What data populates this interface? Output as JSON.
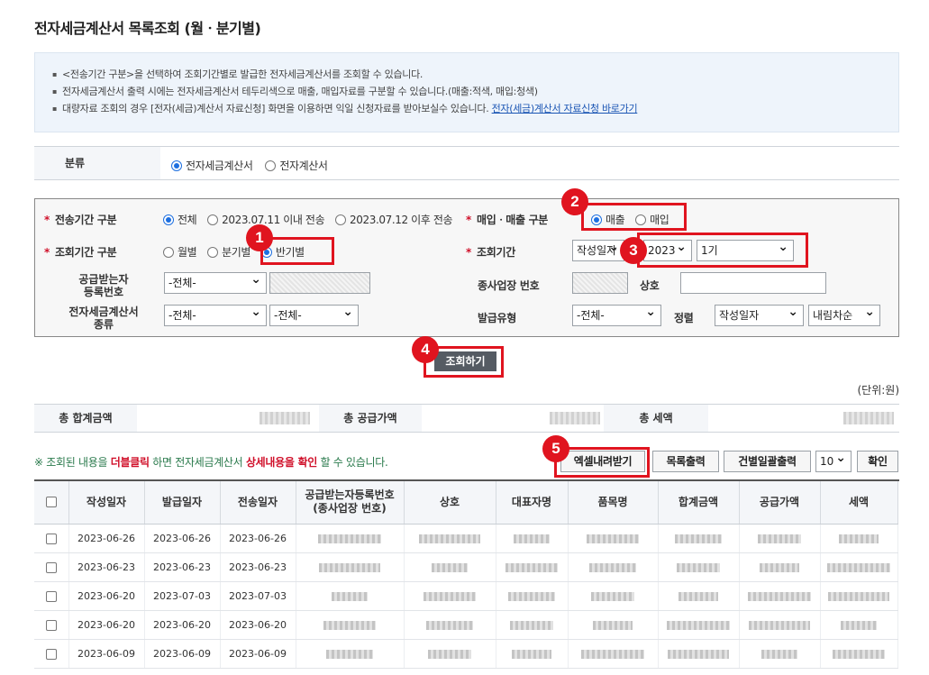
{
  "page_title": "전자세금계산서 목록조회 (월ㆍ분기별)",
  "notice": {
    "lines": [
      "<전송기간 구분>을 선택하여 조회기간별로 발급한 전자세금계산서를 조회할 수 있습니다.",
      "전자세금계산서 출력 시에는 전자세금계산서 테두리색으로 매출, 매입자료를 구분할 수 있습니다.(매출:적색, 매입:청색)",
      "대량자료 조회의 경우 [전자(세금)계산서 자료신청] 화면을 이용하면 익일 신청자료를 받아보실수 있습니다. "
    ],
    "link": "전자(세금)계산서 자료신청 바로가기"
  },
  "classification": {
    "label": "분류",
    "options": [
      "전자세금계산서",
      "전자계산서"
    ],
    "selected": "전자세금계산서"
  },
  "search": {
    "send_period_label": "전송기간 구분",
    "send_period_options": [
      "전체",
      "2023.07.11 이내 전송",
      "2023.07.12 이후 전송"
    ],
    "trade_type_label": "매입ㆍ매출 구분",
    "trade_type_options": [
      "매출",
      "매입"
    ],
    "query_period_label": "조회기간 구분",
    "query_period_options": [
      "월별",
      "분기별",
      "반기별"
    ],
    "query_range_label": "조회기간",
    "date_basis": "작성일자",
    "year": "2023",
    "half": "1기",
    "buyer_reg_label": "공급받는자\n등록번호",
    "buyer_reg_select": "-전체-",
    "branch_label": "종사업장 번호",
    "company_label": "상호",
    "invoice_kind_label": "전자세금계산서\n종류",
    "invoice_kind_select1": "-전체-",
    "invoice_kind_select2": "-전체-",
    "issue_type_label": "발급유형",
    "issue_type_select": "-전체-",
    "sort_label": "정렬",
    "sort_field": "작성일자",
    "sort_order": "내림차순",
    "search_button": "조회하기"
  },
  "badges": [
    "1",
    "2",
    "3",
    "4",
    "5"
  ],
  "unit": "(단위:원)",
  "summary": {
    "total_label": "총 합계금액",
    "supply_label": "총 공급가액",
    "tax_label": "총 세액"
  },
  "hint": {
    "part1": "※ 조회된 내용을 ",
    "em1": "더블클릭",
    "part2": " 하면 전자세금계산서 ",
    "em2": "상세내용을 확인",
    "part3": " 할 수 있습니다."
  },
  "toolbar": {
    "excel": "엑셀내려받기",
    "print_list": "목록출력",
    "bulk_print": "건별일괄출력",
    "page_size": "10",
    "confirm": "확인"
  },
  "table": {
    "headers": [
      "작성일자",
      "발급일자",
      "전송일자",
      "공급받는자등록번호\n(종사업장 번호)",
      "상호",
      "대표자명",
      "품목명",
      "합계금액",
      "공급가액",
      "세액"
    ],
    "rows": [
      [
        "2023-06-26",
        "2023-06-26",
        "2023-06-26"
      ],
      [
        "2023-06-23",
        "2023-06-23",
        "2023-06-23"
      ],
      [
        "2023-06-20",
        "2023-07-03",
        "2023-07-03"
      ],
      [
        "2023-06-20",
        "2023-06-20",
        "2023-06-20"
      ],
      [
        "2023-06-09",
        "2023-06-09",
        "2023-06-09"
      ]
    ]
  }
}
